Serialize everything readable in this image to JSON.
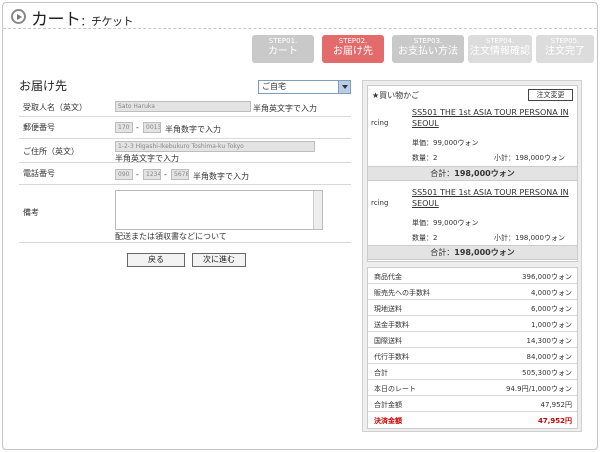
{
  "header": {
    "title": "カート",
    "subtitle": "：チケット"
  },
  "steps": [
    {
      "num": "STEP01.",
      "label": "カート"
    },
    {
      "num": "STEP02.",
      "label": "お届け先"
    },
    {
      "num": "STEP03.",
      "label": "お支払い方法"
    },
    {
      "num": "STEP04.",
      "label": "注文情報確認"
    },
    {
      "num": "STEP05.",
      "label": "注文完了"
    }
  ],
  "form": {
    "title": "お届け先",
    "address_select": "ご自宅",
    "recipient": {
      "label": "受取人名（英文）",
      "value": "Sato Haruka",
      "hint": "半角英文字で入力"
    },
    "postal": {
      "label": "郵便番号",
      "part1": "170",
      "part2": "0013",
      "hint": "半角数字で入力"
    },
    "address": {
      "label": "ご住所（英文）",
      "value": "1-2-3 Higashi-Ikebukuro Toshima-ku Tokyo",
      "hint": "半角英文字で入力"
    },
    "phone": {
      "label": "電話番号",
      "part1": "090",
      "part2": "1234",
      "part3": "5678",
      "hint": "半角数字で入力"
    },
    "notes": {
      "label": "備考",
      "hint": "配送または領収書などについて"
    },
    "back_label": "戻る",
    "next_label": "次に進む",
    "dash": "-"
  },
  "cart": {
    "title": "買い物かご",
    "change_label": "注文変更",
    "items": [
      {
        "img": "rcing",
        "name": "SS501 THE 1st ASIA TOUR PERSONA IN SEOUL",
        "price": "単価：99,000ウォン",
        "qty": "数量：2",
        "subtotal": "小計：198,000ウォン",
        "total_label": "合計：",
        "total": "198,000ウォン"
      },
      {
        "img": "rcing",
        "name": "SS501 THE 1st ASIA TOUR PERSONA IN SEOUL",
        "price": "単価：99,000ウォン",
        "qty": "数量：2",
        "subtotal": "小計：198,000ウォン",
        "total_label": "合計：",
        "total": "198,000ウォン"
      }
    ]
  },
  "summary": [
    {
      "k": "商品代金",
      "v": "396,000ウォン"
    },
    {
      "k": "販売先への手数料",
      "v": "4,000ウォン"
    },
    {
      "k": "現地送料",
      "v": "6,000ウォン"
    },
    {
      "k": "送金手数料",
      "v": "1,000ウォン"
    },
    {
      "k": "国際送料",
      "v": "14,300ウォン"
    },
    {
      "k": "代行手数料",
      "v": "84,000ウォン"
    },
    {
      "k": "合計",
      "v": "505,300ウォン"
    },
    {
      "k": "本日のレート",
      "v": "94.9円/1,000ウォン"
    },
    {
      "k": "合計金額",
      "v": "47,952円"
    },
    {
      "k": "決済金額",
      "v": "47,952円"
    }
  ]
}
